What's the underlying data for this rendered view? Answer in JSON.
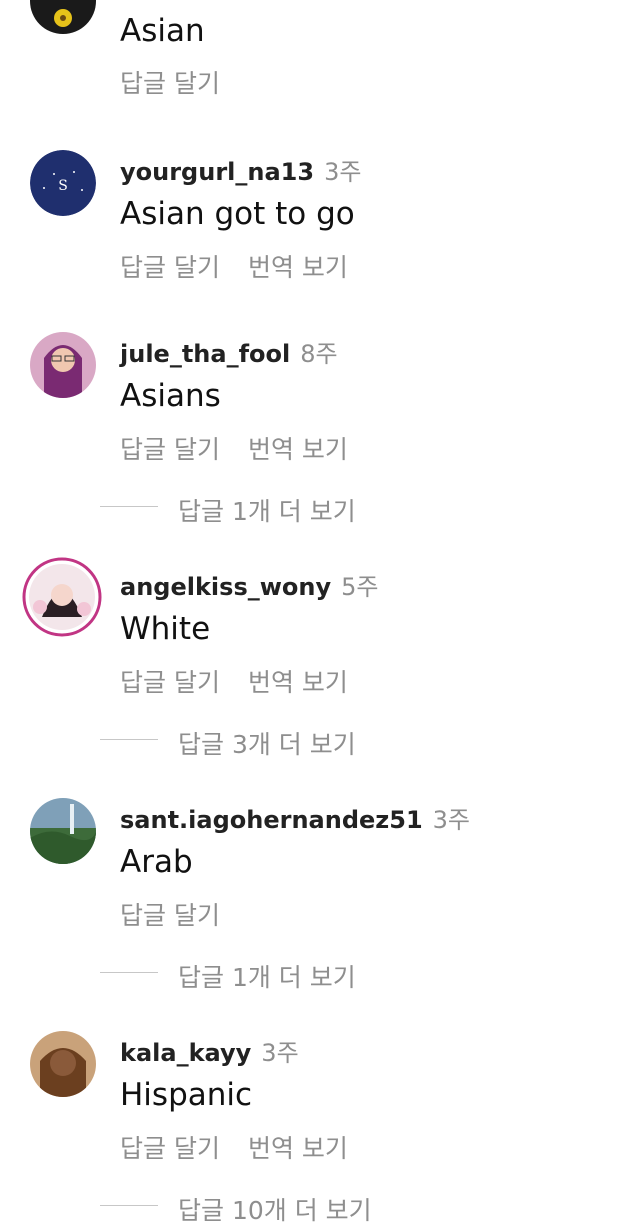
{
  "comments": [
    {
      "username": "",
      "time": "",
      "text": "Asian",
      "reply_label": "답글 달기",
      "translate_label": ""
    },
    {
      "username": "yourgurl_na13",
      "time": "3주",
      "text": "Asian got to go",
      "reply_label": "답글 달기",
      "translate_label": "번역 보기"
    },
    {
      "username": "jule_tha_fool",
      "time": "8주",
      "text": "Asians",
      "reply_label": "답글 달기",
      "translate_label": "번역 보기",
      "more_replies": "답글 1개 더 보기"
    },
    {
      "username": "angelkiss_wony",
      "time": "5주",
      "text": "White",
      "reply_label": "답글 달기",
      "translate_label": "번역 보기",
      "more_replies": "답글 3개 더 보기"
    },
    {
      "username": "sant.iagohernandez51",
      "time": "3주",
      "text": "Arab",
      "reply_label": "답글 달기",
      "translate_label": "",
      "more_replies": "답글 1개 더 보기"
    },
    {
      "username": "kala_kayy",
      "time": "3주",
      "text": "Hispanic",
      "reply_label": "답글 달기",
      "translate_label": "번역 보기",
      "more_replies": "답글 10개 더 보기"
    }
  ],
  "icons": {
    "avatar_0": "profile-photo-avatar",
    "avatar_1": "navy-logo-avatar",
    "avatar_2": "profile-photo-avatar",
    "avatar_3": "profile-photo-avatar-story-ring",
    "avatar_4": "landscape-photo-avatar",
    "avatar_5": "profile-photo-avatar"
  },
  "colors": {
    "text": "#111111",
    "secondary": "#8e8e8e",
    "story_ring": "#c13584"
  }
}
